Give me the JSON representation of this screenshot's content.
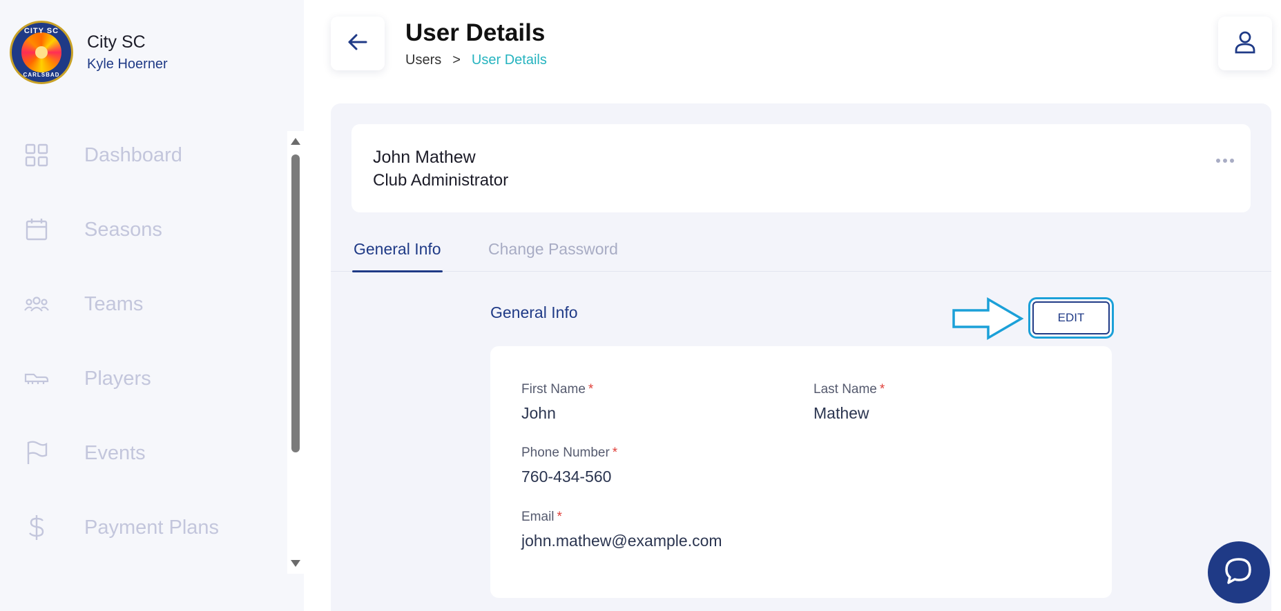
{
  "sidebar": {
    "club_name": "City SC",
    "user_name": "Kyle Hoerner",
    "logo_text_top": "CITY SC",
    "logo_text_bottom": "CARLSBAD",
    "items": [
      {
        "label": "Dashboard",
        "icon": "grid-icon"
      },
      {
        "label": "Seasons",
        "icon": "calendar-icon"
      },
      {
        "label": "Teams",
        "icon": "team-icon"
      },
      {
        "label": "Players",
        "icon": "cleat-icon"
      },
      {
        "label": "Events",
        "icon": "flag-icon"
      },
      {
        "label": "Payment Plans",
        "icon": "dollar-icon"
      }
    ]
  },
  "header": {
    "title": "User Details",
    "breadcrumb": {
      "parent": "Users",
      "separator": ">",
      "current": "User Details"
    }
  },
  "user_card": {
    "name": "John Mathew",
    "role": "Club Administrator"
  },
  "tabs": [
    {
      "label": "General Info",
      "active": true
    },
    {
      "label": "Change Password",
      "active": false
    }
  ],
  "general_info": {
    "title": "General Info",
    "edit_label": "EDIT",
    "fields": {
      "first_name": {
        "label": "First Name",
        "value": "John"
      },
      "last_name": {
        "label": "Last Name",
        "value": "Mathew"
      },
      "phone": {
        "label": "Phone Number",
        "value": "760-434-560"
      },
      "email": {
        "label": "Email",
        "value": "john.mathew@example.com"
      }
    },
    "required_marker": "*"
  },
  "colors": {
    "primary": "#1f3a86",
    "accent_teal": "#25b3bf",
    "annotation_blue": "#1ba0d8",
    "muted_nav": "#c3c6dc",
    "required": "#e0403a"
  }
}
